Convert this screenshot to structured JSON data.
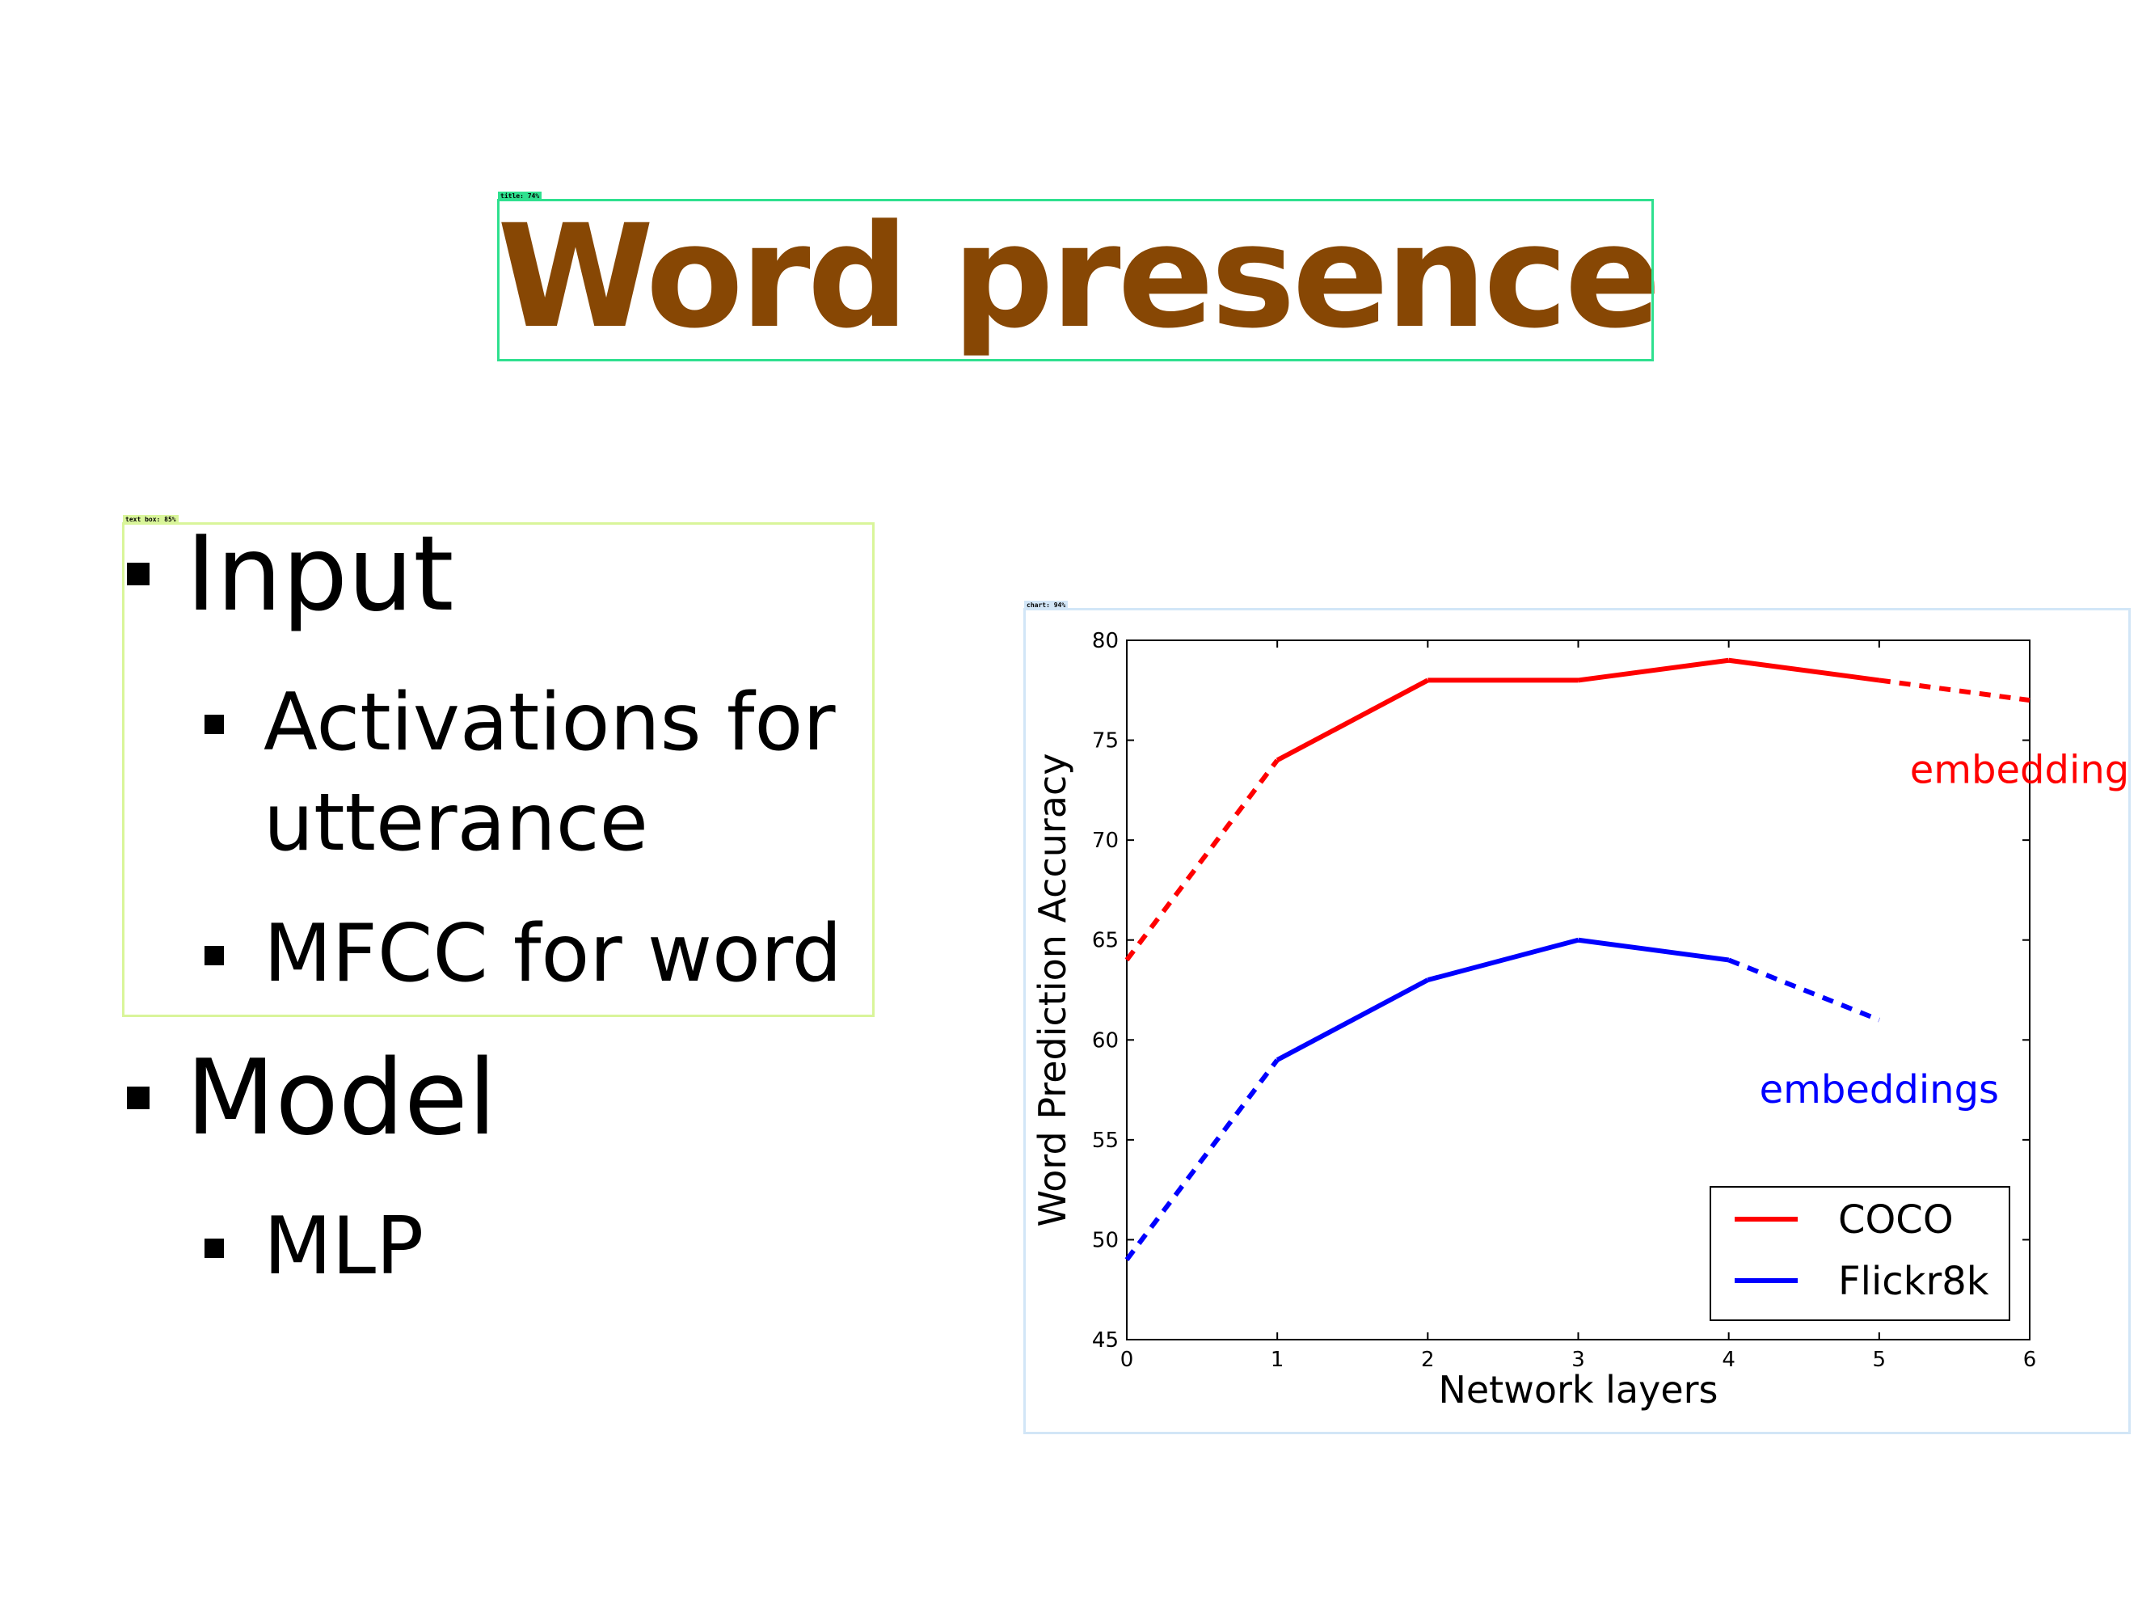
{
  "slide": {
    "title": "Word presence",
    "bullets": {
      "input": "Input",
      "activations_line1": "Activations for",
      "activations_line2": "utterance",
      "mfcc": "MFCC for word",
      "model": "Model",
      "mlp": "MLP"
    }
  },
  "detections": {
    "title": "title: 74%",
    "text_box": "text box: 85%",
    "chart": "chart: 94%"
  },
  "colors": {
    "title": "#874704",
    "coco": "#ff0000",
    "flickr": "#0000ff",
    "title_box": "#2fe08f",
    "text_box": "#d9f59a",
    "chart_box": "#d2e6f7"
  },
  "chart_data": {
    "type": "line",
    "xlabel": "Network layers",
    "ylabel": "Word Prediction Accuracy",
    "xlim": [
      0,
      6
    ],
    "ylim": [
      45,
      80
    ],
    "xticks": [
      0,
      1,
      2,
      3,
      4,
      5,
      6
    ],
    "yticks": [
      45,
      50,
      55,
      60,
      65,
      70,
      75,
      80
    ],
    "grid": false,
    "legend": {
      "position": "bottom-right"
    },
    "series": [
      {
        "name": "COCO",
        "color": "#ff0000",
        "x": [
          0,
          1,
          2,
          3,
          4,
          5,
          6
        ],
        "y": [
          64,
          74,
          78,
          78,
          79,
          78,
          77
        ],
        "dashed_segments": [
          [
            0,
            1
          ],
          [
            5,
            6
          ]
        ]
      },
      {
        "name": "Flickr8k",
        "color": "#0000ff",
        "x": [
          0,
          1,
          2,
          3,
          4,
          5
        ],
        "y": [
          49,
          59,
          63,
          65,
          64,
          61
        ],
        "dashed_segments": [
          [
            0,
            1
          ],
          [
            4,
            5
          ]
        ]
      }
    ],
    "annotations": [
      {
        "text": "embeddings",
        "x": 6,
        "y": 73.5,
        "series": "COCO"
      },
      {
        "text": "embeddings",
        "x": 5,
        "y": 57.5,
        "series": "Flickr8k"
      }
    ]
  }
}
